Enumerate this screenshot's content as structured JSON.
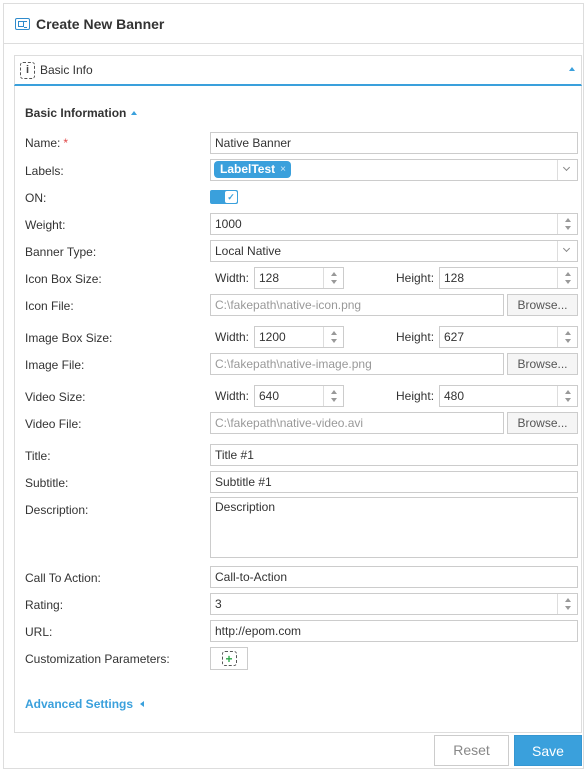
{
  "header": {
    "title": "Create New Banner",
    "icon": "banner-icon"
  },
  "tab": {
    "label": "Basic Info",
    "icon": "info-icon"
  },
  "section": {
    "title": "Basic Information"
  },
  "labels": {
    "name": "Name:",
    "name_required": "*",
    "labels": "Labels:",
    "on": "ON:",
    "weight": "Weight:",
    "banner_type": "Banner Type:",
    "icon_box_size": "Icon Box Size:",
    "icon_file": "Icon File:",
    "image_box_size": "Image Box Size:",
    "image_file": "Image File:",
    "video_size": "Video Size:",
    "video_file": "Video File:",
    "title": "Title:",
    "subtitle": "Subtitle:",
    "description": "Description:",
    "call_to_action": "Call To Action:",
    "rating": "Rating:",
    "url": "URL:",
    "customization_parameters": "Customization Parameters:",
    "width": "Width:",
    "height": "Height:"
  },
  "values": {
    "name": "Native Banner",
    "label_tag": "LabelTest",
    "label_tag_remove": "×",
    "on": true,
    "weight": "1000",
    "banner_type": "Local Native",
    "icon_width": "128",
    "icon_height": "128",
    "icon_file": "C:\\fakepath\\native-icon.png",
    "image_width": "1200",
    "image_height": "627",
    "image_file": "C:\\fakepath\\native-image.png",
    "video_width": "640",
    "video_height": "480",
    "video_file": "C:\\fakepath\\native-video.avi",
    "title": "Title #1",
    "subtitle": "Subtitle #1",
    "description": "Description",
    "call_to_action": "Call-to-Action",
    "rating": "3",
    "url": "http://epom.com"
  },
  "buttons": {
    "browse": "Browse...",
    "reset": "Reset",
    "save": "Save"
  },
  "advanced": {
    "label": "Advanced Settings"
  },
  "colors": {
    "accent": "#3aa0dc",
    "required": "#e04848",
    "add": "#2ea84a"
  }
}
